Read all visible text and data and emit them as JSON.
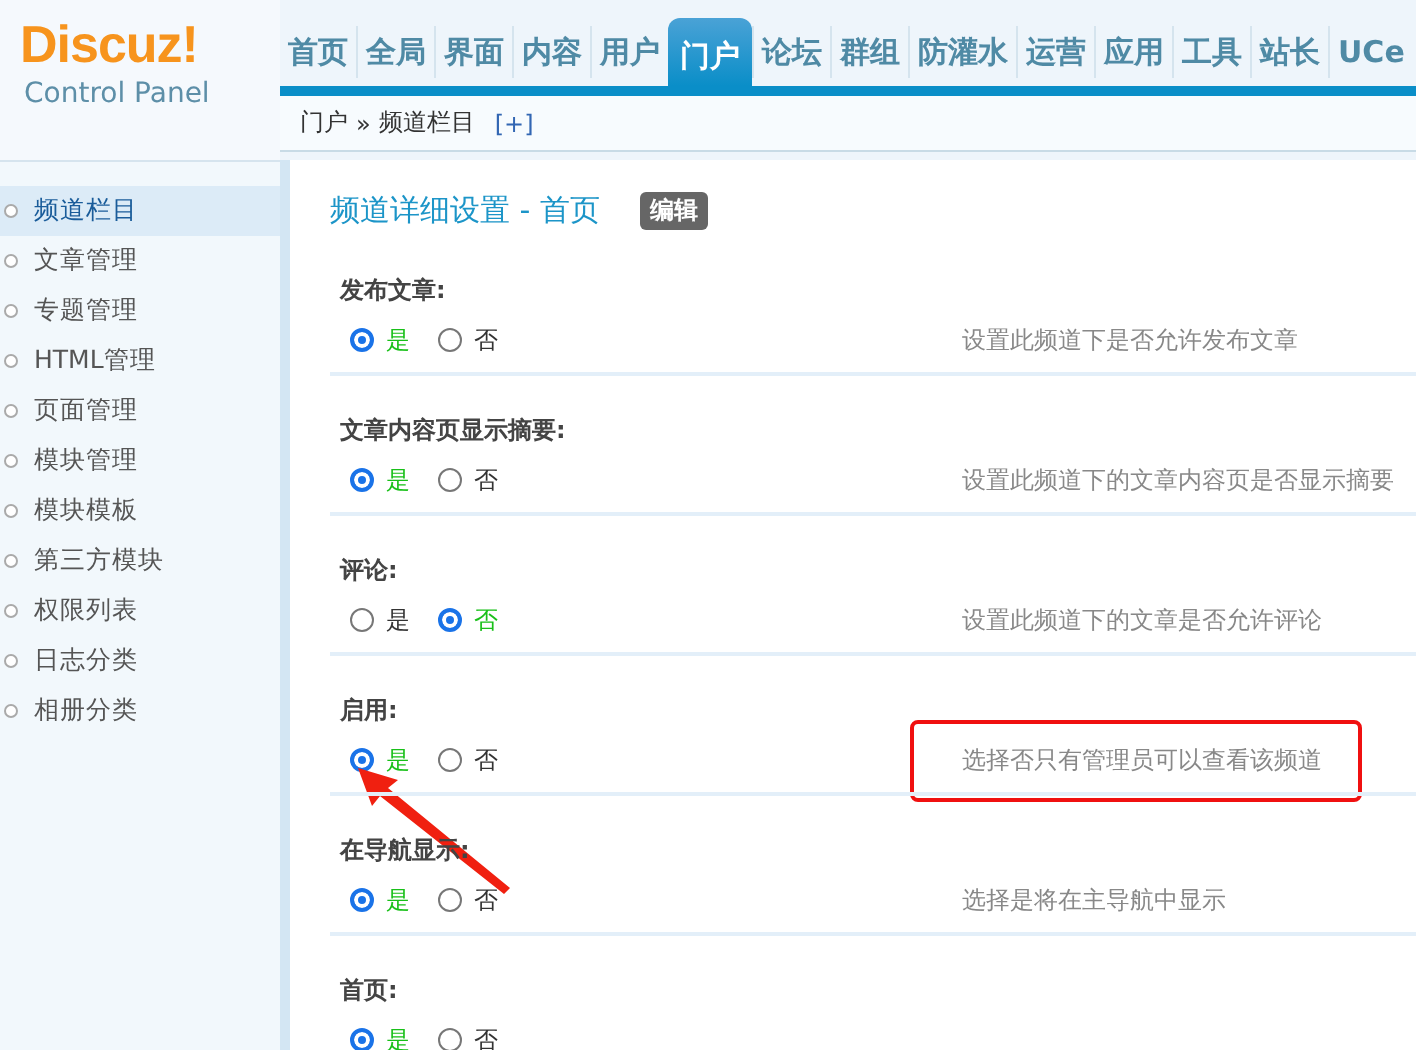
{
  "logo": {
    "brand": "Discuz",
    "mark": "!",
    "subtitle": "Control Panel"
  },
  "nav": [
    {
      "label": "首页",
      "selected": false
    },
    {
      "label": "全局",
      "selected": false
    },
    {
      "label": "界面",
      "selected": false
    },
    {
      "label": "内容",
      "selected": false
    },
    {
      "label": "用户",
      "selected": false
    },
    {
      "label": "门户",
      "selected": true
    },
    {
      "label": "论坛",
      "selected": false
    },
    {
      "label": "群组",
      "selected": false
    },
    {
      "label": "防灌水",
      "selected": false
    },
    {
      "label": "运营",
      "selected": false
    },
    {
      "label": "应用",
      "selected": false
    },
    {
      "label": "工具",
      "selected": false
    },
    {
      "label": "站长",
      "selected": false
    },
    {
      "label": "UCe",
      "selected": false
    }
  ],
  "breadcrumb": {
    "items": [
      "门户",
      "频道栏目"
    ],
    "separator": "»",
    "add": "[+]"
  },
  "sidebar": {
    "items": [
      {
        "label": "频道栏目",
        "selected": true
      },
      {
        "label": "文章管理",
        "selected": false
      },
      {
        "label": "专题管理",
        "selected": false
      },
      {
        "label": "HTML管理",
        "selected": false
      },
      {
        "label": "页面管理",
        "selected": false
      },
      {
        "label": "模块管理",
        "selected": false
      },
      {
        "label": "模块模板",
        "selected": false
      },
      {
        "label": "第三方模块",
        "selected": false
      },
      {
        "label": "权限列表",
        "selected": false
      },
      {
        "label": "日志分类",
        "selected": false
      },
      {
        "label": "相册分类",
        "selected": false
      }
    ]
  },
  "panel": {
    "title": "频道详细设置 - 首页",
    "edit_button": "编辑",
    "rows": [
      {
        "label": "发布文章:",
        "options": [
          {
            "label": "是",
            "selected": true
          },
          {
            "label": "否",
            "selected": false
          }
        ],
        "description": "设置此频道下是否允许发布文章"
      },
      {
        "label": "文章内容页显示摘要:",
        "options": [
          {
            "label": "是",
            "selected": true
          },
          {
            "label": "否",
            "selected": false
          }
        ],
        "description": "设置此频道下的文章内容页是否显示摘要"
      },
      {
        "label": "评论:",
        "options": [
          {
            "label": "是",
            "selected": false
          },
          {
            "label": "否",
            "selected": true
          }
        ],
        "description": "设置此频道下的文章是否允许评论"
      },
      {
        "label": "启用:",
        "options": [
          {
            "label": "是",
            "selected": true
          },
          {
            "label": "否",
            "selected": false
          }
        ],
        "description": "选择否只有管理员可以查看该频道",
        "annotated": true
      },
      {
        "label": "在导航显示:",
        "options": [
          {
            "label": "是",
            "selected": true
          },
          {
            "label": "否",
            "selected": false
          }
        ],
        "description": "选择是将在主导航中显示"
      },
      {
        "label": "首页:",
        "options": [
          {
            "label": "是",
            "selected": true
          },
          {
            "label": "否",
            "selected": false
          }
        ]
      }
    ]
  }
}
